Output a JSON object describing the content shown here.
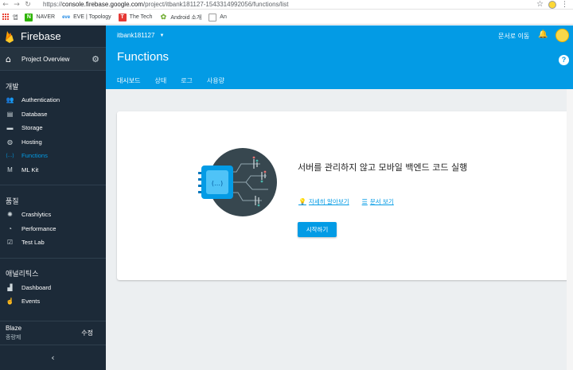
{
  "browser": {
    "url_scheme": "https://",
    "url_host": "console.firebase.google.com",
    "url_path": "/project/itbank181127-1543314992056/functions/list",
    "bookmarks": [
      {
        "label": "앱",
        "icon": "apps-grid-icon"
      },
      {
        "label": "NAVER",
        "icon": "naver-icon",
        "color": "#2db400"
      },
      {
        "label": "EVE | Topology",
        "icon": "eve-icon",
        "color": "#1e88e5"
      },
      {
        "label": "The Tech",
        "icon": "tech-icon",
        "color": "#e53935"
      },
      {
        "label": "Android 소개",
        "icon": "android-icon",
        "color": "#7cb342"
      },
      {
        "label": "An",
        "icon": "page-icon",
        "color": "#9e9e9e"
      }
    ]
  },
  "sidebar": {
    "brand": "Firebase",
    "overview": "Project Overview",
    "sections": [
      {
        "title": "개발",
        "items": [
          {
            "label": "Authentication",
            "icon": "people-icon",
            "glyph": "👥",
            "active": false
          },
          {
            "label": "Database",
            "icon": "database-icon",
            "glyph": "▤",
            "active": false
          },
          {
            "label": "Storage",
            "icon": "folder-icon",
            "glyph": "▬",
            "active": false
          },
          {
            "label": "Hosting",
            "icon": "globe-icon",
            "glyph": "◍",
            "active": false
          },
          {
            "label": "Functions",
            "icon": "functions-icon",
            "glyph": "(…)",
            "active": true
          },
          {
            "label": "ML Kit",
            "icon": "ml-kit-icon",
            "glyph": "M",
            "active": false
          }
        ]
      },
      {
        "title": "품질",
        "items": [
          {
            "label": "Crashlytics",
            "icon": "crashlytics-icon",
            "glyph": "✺",
            "active": false
          },
          {
            "label": "Performance",
            "icon": "speedometer-icon",
            "glyph": "◔",
            "active": false
          },
          {
            "label": "Test Lab",
            "icon": "test-lab-icon",
            "glyph": "☑",
            "active": false
          }
        ]
      },
      {
        "title": "애널리틱스",
        "items": [
          {
            "label": "Dashboard",
            "icon": "bar-chart-icon",
            "glyph": "▟",
            "active": false
          },
          {
            "label": "Events",
            "icon": "events-icon",
            "glyph": "☝",
            "active": false
          }
        ]
      }
    ],
    "plan_name": "Blaze",
    "plan_sub": "종량제",
    "modify": "수정",
    "collapse": "‹"
  },
  "header": {
    "project": "itbank181127",
    "docs": "문서로 이동",
    "title": "Functions",
    "help": "?",
    "tabs": [
      {
        "label": "대시보드",
        "active": true
      },
      {
        "label": "상태",
        "active": false
      },
      {
        "label": "로그",
        "active": false
      },
      {
        "label": "사용량",
        "active": false
      }
    ]
  },
  "main": {
    "headline": "서버를 관리하지 않고 모바일 백엔드 코드 실행",
    "learn_more": "자세히 알아보기",
    "view_docs": "문서 보기",
    "start_button": "시작하기"
  },
  "colors": {
    "accent": "#039be5",
    "sidebar_bg": "#1c2a38",
    "main_bg": "#eceff1"
  }
}
